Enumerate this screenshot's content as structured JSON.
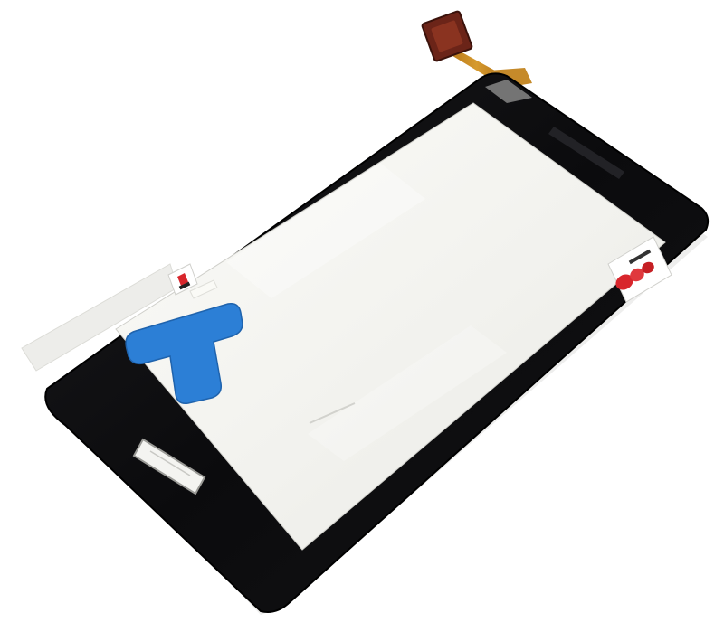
{
  "photo": {
    "subject": "touchscreen-digitizer-panel",
    "stickers": {
      "left_brand_text": "",
      "right_brand_text": ""
    },
    "colors": {
      "background": "#ffffff",
      "bezel": "#0d0d0f",
      "glass": "#f4f4f1",
      "protective_film_edge": "#e6e6e2",
      "blue_tab": "#2c7fd6",
      "flex_cable": "#c98a1f",
      "connector": "#6b2418",
      "sticker_red": "#d8262c"
    }
  }
}
